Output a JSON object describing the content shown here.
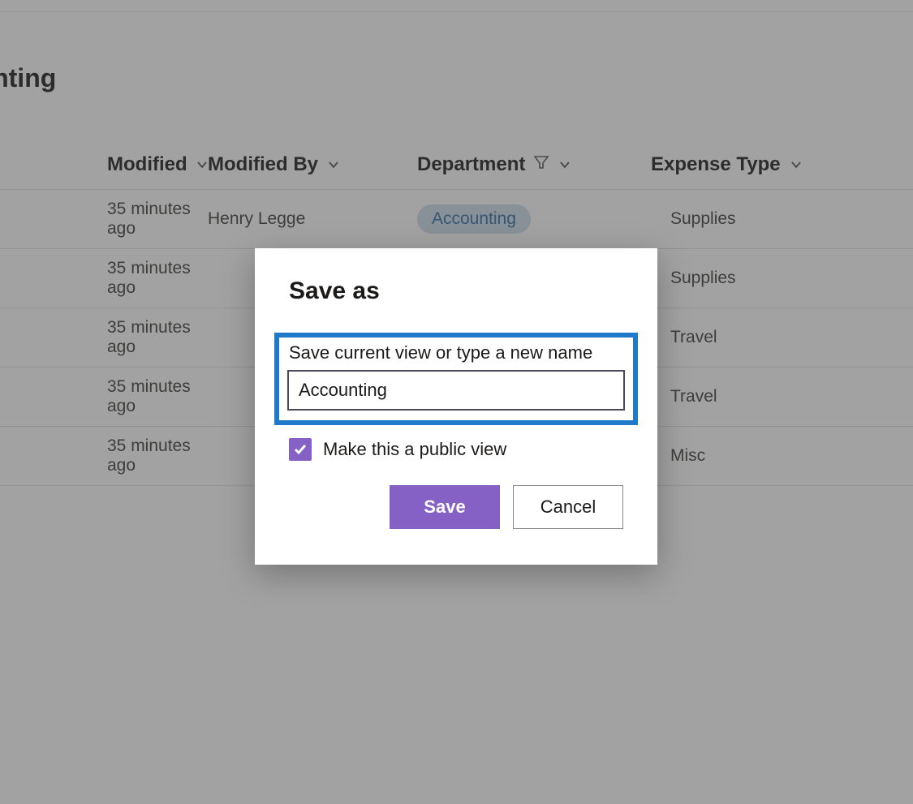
{
  "view_title": "ounting",
  "columns": {
    "modified": "Modified",
    "modified_by": "Modified By",
    "department": "Department",
    "expense_type": "Expense Type"
  },
  "rows": [
    {
      "modified": "35 minutes ago",
      "modified_by": "Henry Legge",
      "department": "Accounting",
      "expense_type": "Supplies"
    },
    {
      "modified": "35 minutes ago",
      "modified_by": "",
      "department": "",
      "expense_type": "Supplies"
    },
    {
      "modified": "35 minutes ago",
      "modified_by": "",
      "department": "",
      "expense_type": "Travel"
    },
    {
      "modified": "35 minutes ago",
      "modified_by": "",
      "department": "",
      "expense_type": "Travel"
    },
    {
      "modified": "35 minutes ago",
      "modified_by": "",
      "department": "",
      "expense_type": "Misc"
    }
  ],
  "dialog": {
    "title": "Save as",
    "field_label": "Save current view or type a new name",
    "input_value": "Accounting",
    "checkbox_label": "Make this a public view",
    "checkbox_checked": true,
    "save_label": "Save",
    "cancel_label": "Cancel"
  },
  "colors": {
    "accent": "#8661c5",
    "highlight_border": "#1f7bc9",
    "pill_bg": "#c9d8e8",
    "pill_fg": "#2c6aa0"
  }
}
